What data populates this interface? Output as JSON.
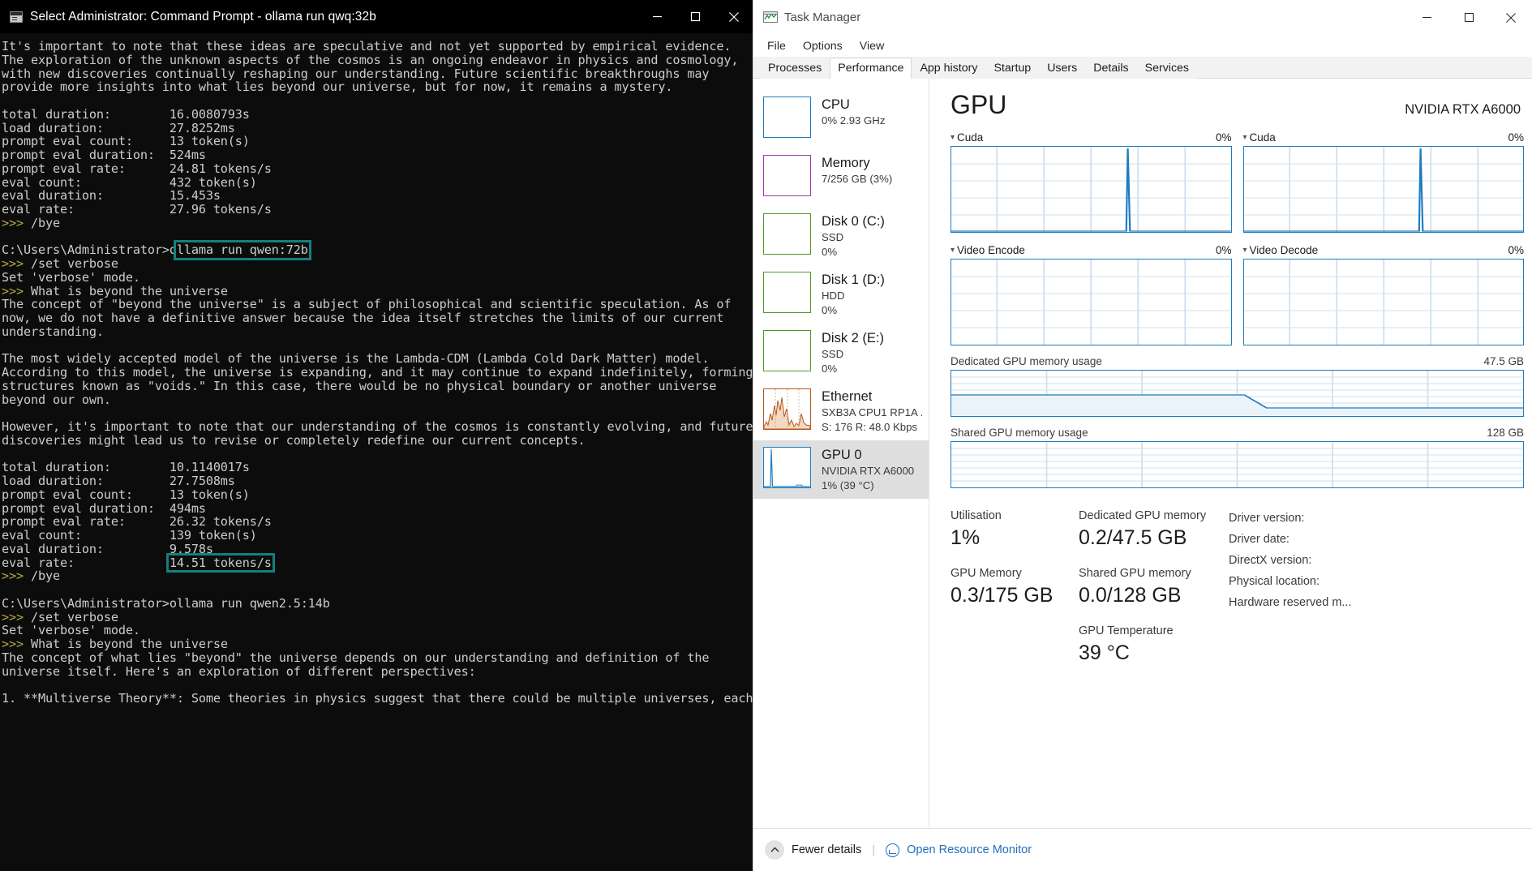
{
  "cmd": {
    "title": "Select Administrator: Command Prompt - ollama  run qwq:32b",
    "icon": "cmd-icon",
    "window_buttons": {
      "minimize": "minimize-icon",
      "maximize": "maximize-icon",
      "close": "close-icon"
    },
    "highlight_color": "#14807c",
    "lines": [
      "It's important to note that these ideas are speculative and not yet supported by empirical evidence.",
      "The exploration of the unknown aspects of the cosmos is an ongoing endeavor in physics and cosmology,",
      "with new discoveries continually reshaping our understanding. Future scientific breakthroughs may",
      "provide more insights into what lies beyond our universe, but for now, it remains a mystery.",
      "",
      "total duration:        16.0080793s",
      "load duration:         27.8252ms",
      "prompt eval count:     13 token(s)",
      "prompt eval duration:  524ms",
      "prompt eval rate:      24.81 tokens/s",
      "eval count:            432 token(s)",
      "eval duration:         15.453s",
      "eval rate:             27.96 tokens/s",
      ">>> /bye",
      "",
      "C:\\Users\\Administrator>ollama run qwen:72b",
      ">>> /set verbose",
      "Set 'verbose' mode.",
      ">>> What is beyond the universe",
      "The concept of \"beyond the universe\" is a subject of philosophical and scientific speculation. As of",
      "now, we do not have a definitive answer because the idea itself stretches the limits of our current",
      "understanding.",
      "",
      "The most widely accepted model of the universe is the Lambda-CDM (Lambda Cold Dark Matter) model.",
      "According to this model, the universe is expanding, and it may continue to expand indefinitely, forming",
      "structures known as \"voids.\" In this case, there would be no physical boundary or another universe",
      "beyond our own.",
      "",
      "However, it's important to note that our understanding of the cosmos is constantly evolving, and future",
      "discoveries might lead us to revise or completely redefine our current concepts.",
      "",
      "total duration:        10.1140017s",
      "load duration:         27.7508ms",
      "prompt eval count:     13 token(s)",
      "prompt eval duration:  494ms",
      "prompt eval rate:      26.32 tokens/s",
      "eval count:            139 token(s)",
      "eval duration:         9.578s",
      "eval rate:             14.51 tokens/s",
      ">>> /bye",
      "",
      "C:\\Users\\Administrator>ollama run qwen2.5:14b",
      ">>> /set verbose",
      "Set 'verbose' mode.",
      ">>> What is beyond the universe",
      "The concept of what lies \"beyond\" the universe depends on our understanding and definition of the",
      "universe itself. Here's an exploration of different perspectives:",
      "",
      "1. **Multiverse Theory**: Some theories in physics suggest that there could be multiple universes, each"
    ],
    "highlights": [
      {
        "line": 15,
        "start": 24,
        "length": 19,
        "text": "ollama run qwen:72b"
      },
      {
        "line": 38,
        "start": 23,
        "length": 16,
        "text": "14.51 tokens/s"
      }
    ]
  },
  "taskmgr": {
    "title": "Task Manager",
    "app_icon": "task-manager-icon",
    "window_buttons": {
      "minimize": "minimize-icon",
      "maximize": "maximize-icon",
      "close": "close-icon"
    },
    "menu": [
      "File",
      "Options",
      "View"
    ],
    "tabs": [
      {
        "label": "Processes",
        "active": false
      },
      {
        "label": "Performance",
        "active": true
      },
      {
        "label": "App history",
        "active": false
      },
      {
        "label": "Startup",
        "active": false
      },
      {
        "label": "Users",
        "active": false
      },
      {
        "label": "Details",
        "active": false
      },
      {
        "label": "Services",
        "active": false
      }
    ],
    "sidebar": [
      {
        "name": "CPU",
        "sub1": "0% 2.93 GHz",
        "sub2": "",
        "color": "#1e7bbf",
        "selected": false
      },
      {
        "name": "Memory",
        "sub1": "7/256 GB (3%)",
        "sub2": "",
        "color": "#a438a4",
        "selected": false
      },
      {
        "name": "Disk 0 (C:)",
        "sub1": "SSD",
        "sub2": "0%",
        "color": "#4e9a24",
        "selected": false
      },
      {
        "name": "Disk 1 (D:)",
        "sub1": "HDD",
        "sub2": "0%",
        "color": "#4e9a24",
        "selected": false
      },
      {
        "name": "Disk 2 (E:)",
        "sub1": "SSD",
        "sub2": "0%",
        "color": "#4e9a24",
        "selected": false
      },
      {
        "name": "Ethernet",
        "sub1": "SXB3A CPU1 RP1A ...",
        "sub2": "S: 176 R: 48.0 Kbps",
        "color": "#b4571b",
        "selected": false
      },
      {
        "name": "GPU 0",
        "sub1": "NVIDIA RTX A6000",
        "sub2": "1% (39 °C)",
        "color": "#1e7bbf",
        "selected": true
      }
    ],
    "detail": {
      "title": "GPU",
      "model": "NVIDIA RTX A6000",
      "graphs": [
        {
          "label": "Cuda",
          "pct": "0%"
        },
        {
          "label": "Cuda",
          "pct": "0%"
        },
        {
          "label": "Video Encode",
          "pct": "0%"
        },
        {
          "label": "Video Decode",
          "pct": "0%"
        }
      ],
      "memory_graphs": [
        {
          "label": "Dedicated GPU memory usage",
          "max": "47.5 GB"
        },
        {
          "label": "Shared GPU memory usage",
          "max": "128 GB"
        }
      ],
      "stats": {
        "utilisation_label": "Utilisation",
        "utilisation_value": "1%",
        "gpu_memory_label": "GPU Memory",
        "gpu_memory_value": "0.3/175 GB",
        "dedicated_label": "Dedicated GPU memory",
        "dedicated_value": "0.2/47.5 GB",
        "shared_label": "Shared GPU memory",
        "shared_value": "0.0/128 GB",
        "temperature_label": "GPU Temperature",
        "temperature_value": "39 °C",
        "driver_version_label": "Driver version:",
        "driver_date_label": "Driver date:",
        "directx_label": "DirectX version:",
        "physical_location_label": "Physical location:",
        "hardware_reserved_label": "Hardware reserved m..."
      }
    },
    "footer": {
      "fewer_details": "Fewer details",
      "separator": "|",
      "open_resource_monitor": "Open Resource Monitor"
    }
  }
}
